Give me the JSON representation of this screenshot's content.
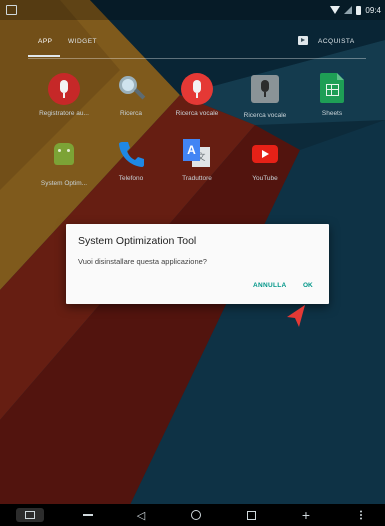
{
  "status_bar": {
    "time": "09:4"
  },
  "tabs": {
    "app": "APP",
    "widget": "WIDGET",
    "store": "ACQUISTA"
  },
  "apps": [
    {
      "label": "Registratore au...",
      "icon": "microphone-red-icon"
    },
    {
      "label": "Ricerca",
      "icon": "magnifier-icon"
    },
    {
      "label": "Ricerca vocale",
      "icon": "microphone-icon"
    },
    {
      "label": "Ricerca vocale",
      "icon": "microphone-grey-icon"
    },
    {
      "label": "Sheets",
      "icon": "sheets-icon"
    },
    {
      "label": "System Optim...",
      "icon": "android-icon"
    },
    {
      "label": "Telefono",
      "icon": "phone-icon"
    },
    {
      "label": "Traduttore",
      "icon": "translate-icon"
    },
    {
      "label": "YouTube",
      "icon": "youtube-icon"
    }
  ],
  "dialog": {
    "title": "System Optimization Tool",
    "message": "Vuoi disinstallare questa applicazione?",
    "cancel_label": "ANNULLA",
    "ok_label": "OK"
  },
  "nav_bar": {
    "volume_down": "—",
    "volume_up": "+",
    "back": "◁"
  },
  "colors": {
    "accent": "#009688",
    "dialog_bg": "#fafafa",
    "pointer": "#e53935"
  }
}
